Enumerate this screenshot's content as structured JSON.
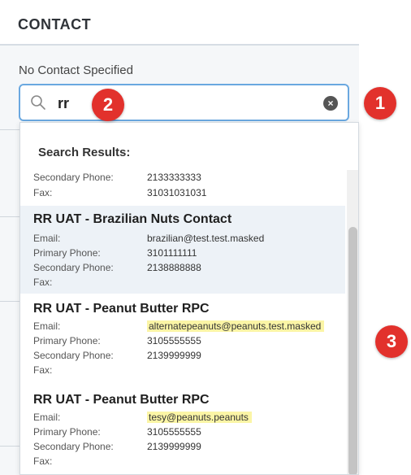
{
  "panel": {
    "title": "CONTACT",
    "no_contact_label": "No Contact Specified"
  },
  "search": {
    "value": "rr",
    "icon": "search-icon",
    "clear_icon": "close-circle-icon",
    "clear_glyph": "×"
  },
  "dropdown": {
    "results_label": "Search Results:"
  },
  "results": [
    {
      "name": "",
      "email": "",
      "primary_phone": "",
      "secondary_phone_label": "Secondary Phone:",
      "secondary_phone": "2133333333",
      "fax_label": "Fax:",
      "fax": "31031031031"
    },
    {
      "name": "RR UAT - Brazilian Nuts Contact",
      "email_label": "Email:",
      "email": "brazilian@test.test.masked",
      "primary_phone_label": "Primary Phone:",
      "primary_phone": "3101111111",
      "secondary_phone_label": "Secondary Phone:",
      "secondary_phone": "2138888888",
      "fax_label": "Fax:",
      "fax": ""
    },
    {
      "name": "RR UAT - Peanut Butter RPC",
      "email_label": "Email:",
      "email": "alternatepeanuts@peanuts.test.masked",
      "primary_phone_label": "Primary Phone:",
      "primary_phone": "3105555555",
      "secondary_phone_label": "Secondary Phone:",
      "secondary_phone": "2139999999",
      "fax_label": "Fax:",
      "fax": ""
    },
    {
      "name": "RR UAT - Peanut Butter RPC",
      "email_label": "Email:",
      "email": "tesy@peanuts.peanuts",
      "primary_phone_label": "Primary Phone:",
      "primary_phone": "3105555555",
      "secondary_phone_label": "Secondary Phone:",
      "secondary_phone": "2139999999",
      "fax_label": "Fax:",
      "fax": ""
    }
  ],
  "callouts": [
    "1",
    "2",
    "3"
  ],
  "colors": {
    "callout": "#e2312c",
    "focus_border": "#6aa8e0",
    "email_highlight": "#fbf5a6",
    "row_highlight": "#edf2f7"
  }
}
